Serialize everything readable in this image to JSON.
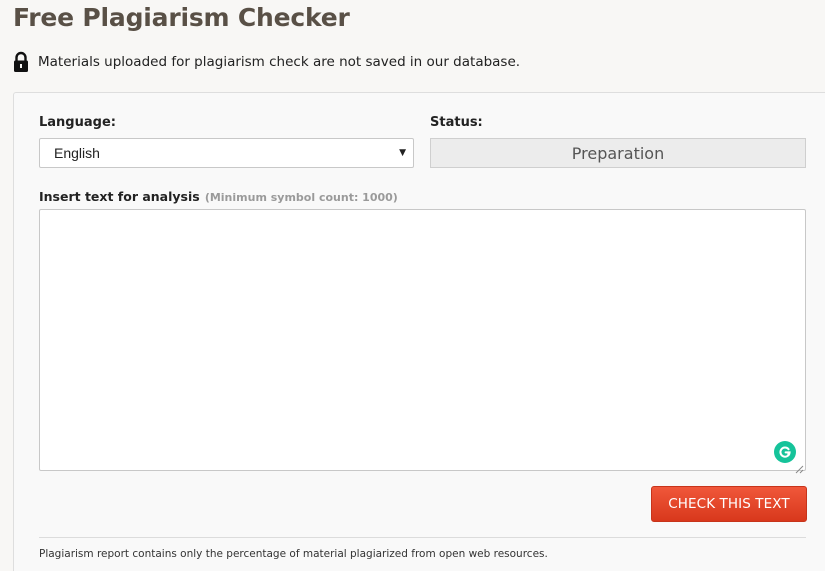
{
  "page": {
    "title": "Free Plagiarism Checker",
    "notice": "Materials uploaded for plagiarism check are not saved in our database."
  },
  "form": {
    "language_label": "Language:",
    "language_value": "English",
    "status_label": "Status:",
    "status_value": "Preparation",
    "insert_label": "Insert text for analysis",
    "insert_hint": "(Minimum symbol count: 1000)",
    "text_value": "",
    "button_label": "CHECK THIS TEXT",
    "footer_note": "Plagiarism report contains only the percentage of material plagiarized from open web resources."
  },
  "colors": {
    "title": "#595046",
    "button": "#e4472a",
    "grammarly": "#15c39a"
  },
  "icons": {
    "notice": "lock-icon",
    "select": "caret-down-icon",
    "textarea_addon": "grammarly-icon"
  }
}
